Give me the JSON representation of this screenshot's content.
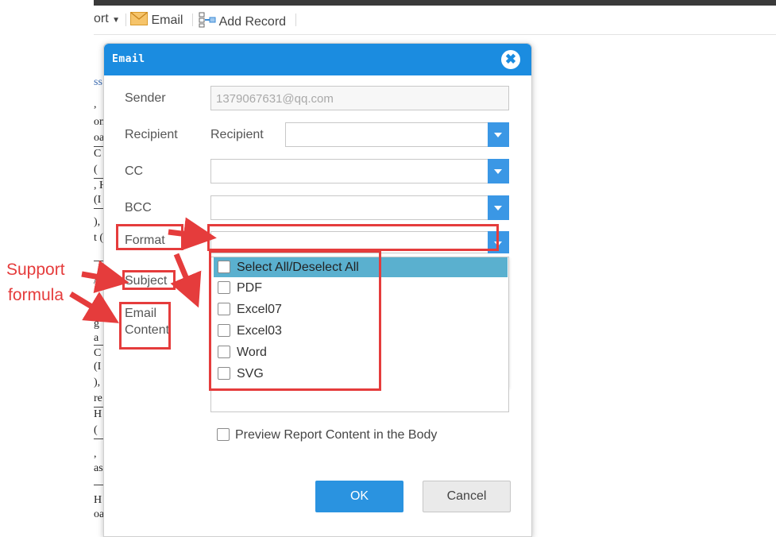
{
  "toolbar": {
    "export_label": "ort",
    "email_label": "Email",
    "add_record_label": "Add Record"
  },
  "background_rows": [
    "ss",
    ",",
    "om",
    "oa",
    "C",
    "(",
    ", H",
    "(I",
    "),",
    "t (",
    "",
    "/u",
    "",
    "g",
    "a",
    "C",
    "(I",
    "),",
    "re",
    "H",
    "(",
    ",",
    "as",
    "",
    "H",
    "oa"
  ],
  "dialog": {
    "title": "Email",
    "close_icon": "close-circle-icon",
    "sender": {
      "label": "Sender",
      "value": "1379067631@qq.com"
    },
    "recipient": {
      "label": "Recipient",
      "sub_label": "Recipient",
      "value": ""
    },
    "cc": {
      "label": "CC",
      "value": ""
    },
    "bcc": {
      "label": "BCC",
      "value": ""
    },
    "format": {
      "label": "Format",
      "value": "",
      "options": [
        {
          "label": "Select All/Deselect All",
          "checked": false,
          "highlighted": true
        },
        {
          "label": "PDF",
          "checked": false
        },
        {
          "label": "Excel07",
          "checked": false
        },
        {
          "label": "Excel03",
          "checked": false
        },
        {
          "label": "Word",
          "checked": false
        },
        {
          "label": "SVG",
          "checked": false
        }
      ]
    },
    "subject": {
      "label": "Subject"
    },
    "email_content": {
      "label_line1": "Email",
      "label_line2": "Content"
    },
    "preview": {
      "label": "Preview Report Content in the Body",
      "checked": false
    },
    "ok_label": "OK",
    "cancel_label": "Cancel"
  },
  "annotation": {
    "line1": "Support",
    "line2": "formula",
    "color": "#e53c3c"
  },
  "colors": {
    "header": "#1b8ce0",
    "ok_button": "#2a93e0",
    "dropdown_button": "#3a97e5",
    "highlight_option": "#5ab0cf"
  }
}
